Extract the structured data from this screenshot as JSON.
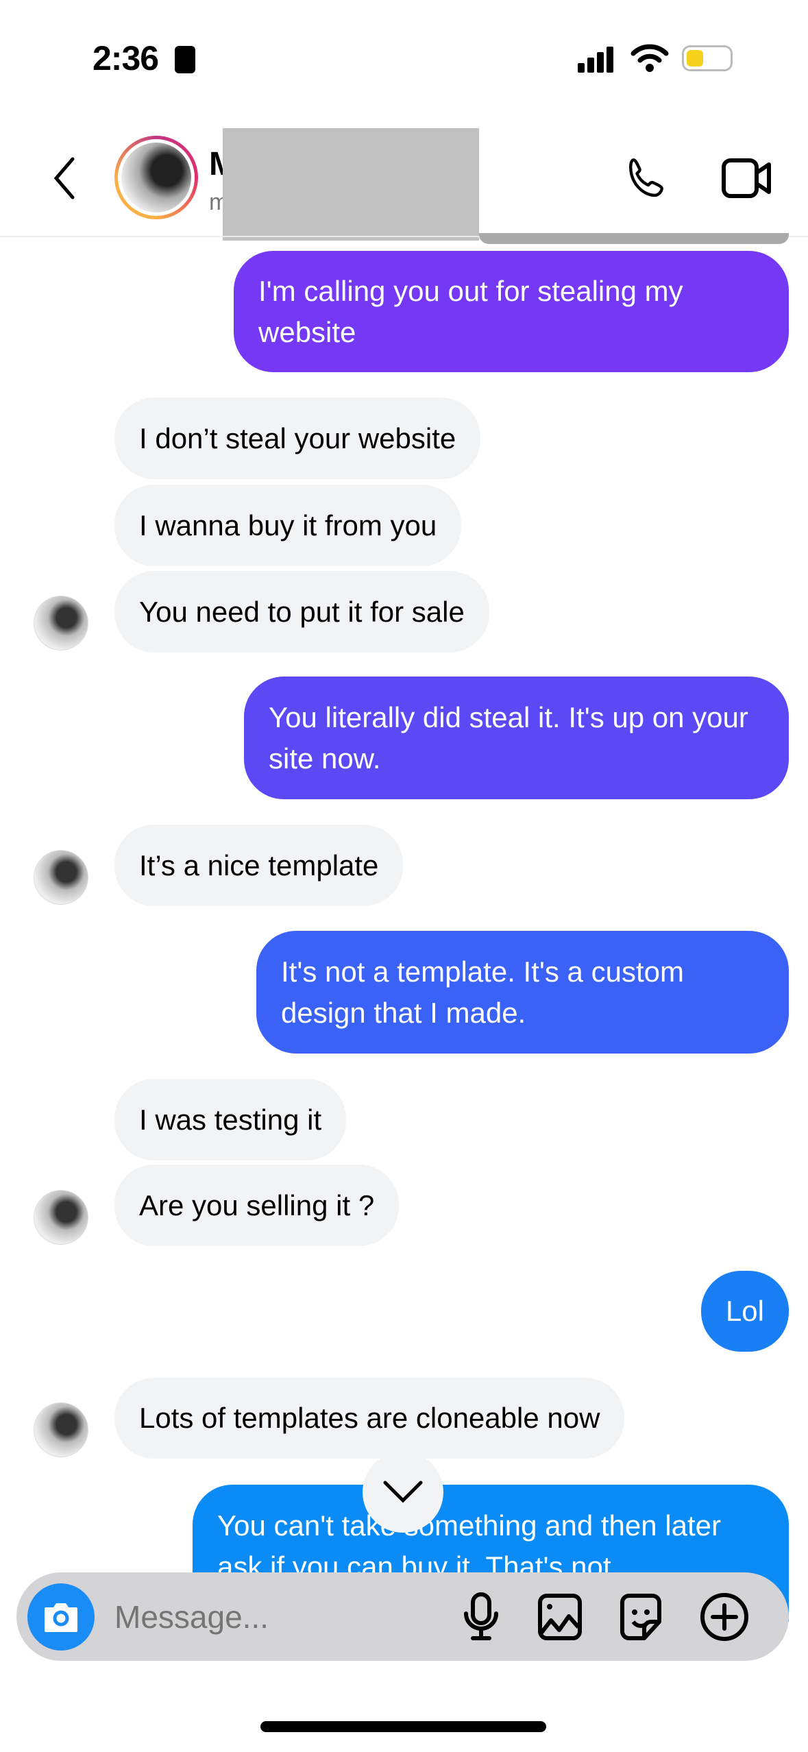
{
  "status_bar": {
    "time": "2:36"
  },
  "header": {
    "name_initial": "M",
    "username_initial": "m",
    "back_icon": "chevron-left-icon",
    "call_icon": "phone-icon",
    "video_icon": "video-camera-icon"
  },
  "messages": [
    {
      "side": "sent",
      "text": "I'm calling you out for stealing my website",
      "color": "#7539f5"
    },
    {
      "side": "received",
      "text": "I don’t steal your website"
    },
    {
      "side": "received",
      "text": "I wanna buy it from you"
    },
    {
      "side": "received",
      "text": "You need to put it for sale"
    },
    {
      "side": "sent",
      "text": "You literally did steal it. It's up on your site now.",
      "color": "#5a49f5"
    },
    {
      "side": "received",
      "text": "It’s a nice template"
    },
    {
      "side": "sent",
      "text": "It's not a template. It's a custom design that I made.",
      "color": "#3a62f6"
    },
    {
      "side": "received",
      "text": "I was testing it"
    },
    {
      "side": "received",
      "text": "Are you selling it ?"
    },
    {
      "side": "sent",
      "text": "Lol",
      "color": "#1a7ef5"
    },
    {
      "side": "received",
      "text": "Lots of templates are cloneable now"
    },
    {
      "side": "sent",
      "text": "You can't take something and then later ask if you can buy it. That's not",
      "color": "#0b8bf5"
    }
  ],
  "composer": {
    "placeholder": "Message...",
    "camera_color": "#1a8cf5"
  }
}
